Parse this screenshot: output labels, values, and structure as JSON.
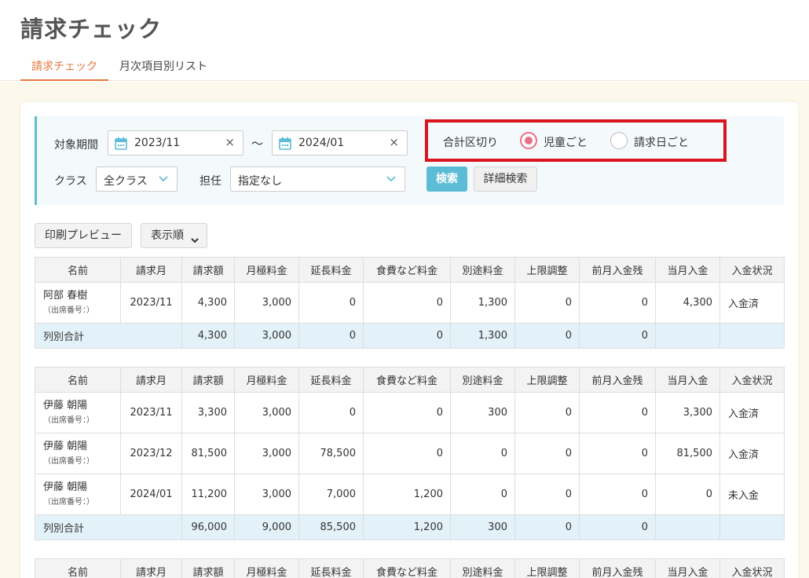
{
  "page": {
    "title": "請求チェック"
  },
  "tabs": [
    "請求チェック",
    "月次項目別リスト"
  ],
  "filter": {
    "period_label": "対象期間",
    "date_from": "2023/11",
    "date_to": "2024/01",
    "tilde": "～",
    "clear_symbol": "×",
    "class_label": "クラス",
    "class_value": "全クラス",
    "teacher_label": "担任",
    "teacher_value": "指定なし",
    "sum_label": "合計区切り",
    "radio_child": "児童ごと",
    "radio_billing_date": "請求日ごと",
    "selected_radio": "児童ごと",
    "search_button": "検索",
    "detail_search_button": "詳細検索"
  },
  "toolbar": {
    "print_preview": "印刷プレビュー",
    "sort_order": "表示順"
  },
  "colors": {
    "accent": "#e8743b",
    "highlight_border": "#d9141f",
    "search_button": "#5cbcd6",
    "radio_selected": "#ea6f8a",
    "paid": "#53a047",
    "unpaid": "#e0463a",
    "total_row": "#e3f2f8"
  },
  "table": {
    "headers": [
      "名前",
      "請求月",
      "請求額",
      "月極料金",
      "延長料金",
      "食費など料金",
      "別途料金",
      "上限調整",
      "前月入金残",
      "当月入金",
      "入金状況"
    ],
    "attendance_no_label": "（出席番号：）",
    "total_label": "列別合計",
    "groups": [
      {
        "rows": [
          {
            "name": "阿部 春樹",
            "month": "2023/11",
            "amount": "4,300",
            "monthly": "3,000",
            "extension": "0",
            "meal": "0",
            "separate": "1,300",
            "cap": "0",
            "prev_balance": "0",
            "current_payment": "4,300",
            "status": "入金済"
          }
        ],
        "total": {
          "amount": "4,300",
          "monthly": "3,000",
          "extension": "0",
          "meal": "0",
          "separate": "1,300",
          "cap": "0",
          "prev_balance": "0"
        }
      },
      {
        "rows": [
          {
            "name": "伊藤 朝陽",
            "month": "2023/11",
            "amount": "3,300",
            "monthly": "3,000",
            "extension": "0",
            "meal": "0",
            "separate": "300",
            "cap": "0",
            "prev_balance": "0",
            "current_payment": "3,300",
            "status": "入金済"
          },
          {
            "name": "伊藤 朝陽",
            "month": "2023/12",
            "amount": "81,500",
            "monthly": "3,000",
            "extension": "78,500",
            "meal": "0",
            "separate": "0",
            "cap": "0",
            "prev_balance": "0",
            "current_payment": "81,500",
            "status": "入金済"
          },
          {
            "name": "伊藤 朝陽",
            "month": "2024/01",
            "amount": "11,200",
            "monthly": "3,000",
            "extension": "7,000",
            "meal": "1,200",
            "separate": "0",
            "cap": "0",
            "prev_balance": "0",
            "current_payment": "0",
            "status": "未入金"
          }
        ],
        "total": {
          "amount": "96,000",
          "monthly": "9,000",
          "extension": "85,500",
          "meal": "1,200",
          "separate": "300",
          "cap": "0",
          "prev_balance": "0"
        }
      }
    ]
  }
}
